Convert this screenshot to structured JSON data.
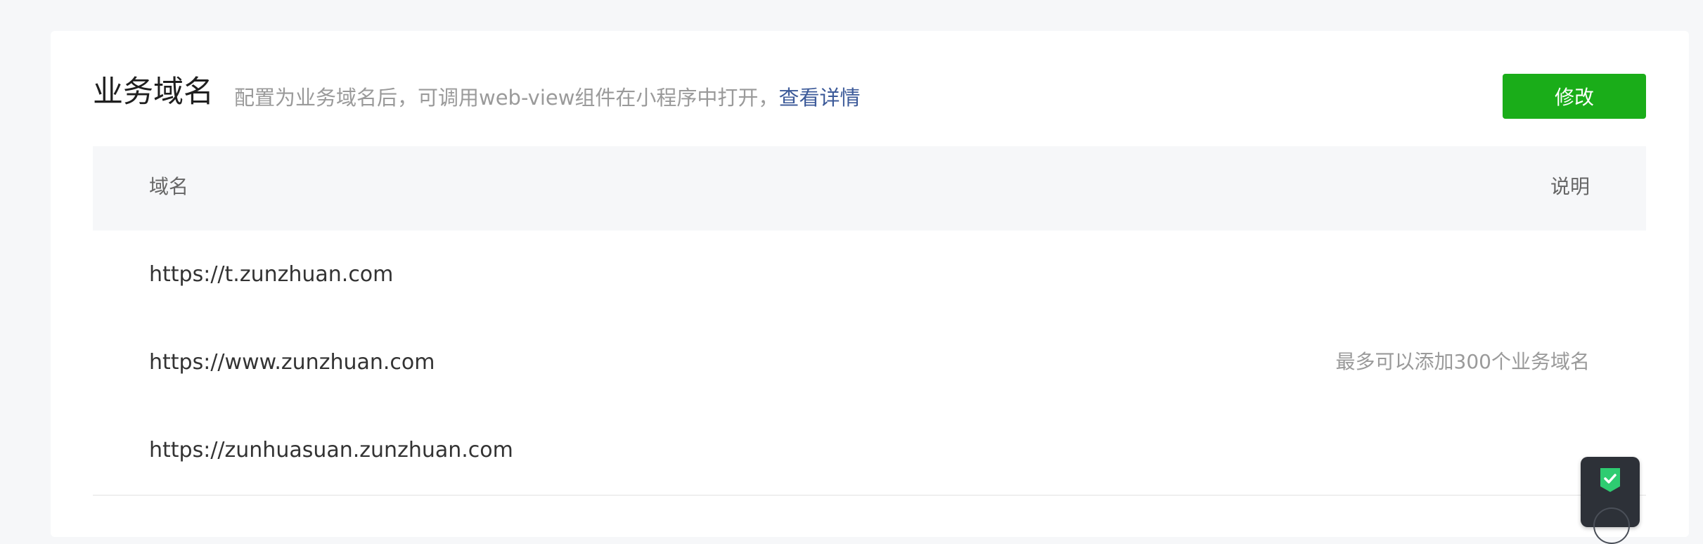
{
  "header": {
    "title": "业务域名",
    "description": "配置为业务域名后，可调用web-view组件在小程序中打开，",
    "details_link": "查看详情",
    "edit_button": "修改"
  },
  "table": {
    "columns": [
      "域名",
      "说明"
    ],
    "rows": [
      {
        "domain": "https://t.zunzhuan.com",
        "note": ""
      },
      {
        "domain": "https://www.zunzhuan.com",
        "note": "最多可以添加300个业务域名"
      },
      {
        "domain": "https://zunhuasuan.zunzhuan.com",
        "note": ""
      }
    ]
  },
  "colors": {
    "accent_green": "#1aad19",
    "link_blue": "#3c5a99",
    "widget_check": "#2ecc71"
  },
  "icons": {
    "floating_widget": "shield-check-icon"
  }
}
